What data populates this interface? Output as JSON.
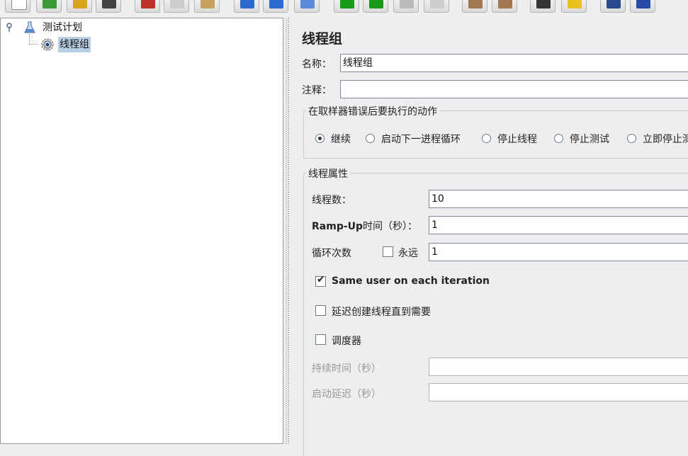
{
  "toolbar": {
    "buttons": [
      {
        "icon": "new-icon",
        "color": "#ffffff"
      },
      {
        "icon": "templates-icon",
        "color": "#3a9a3a"
      },
      {
        "icon": "open-icon",
        "color": "#d8a520"
      },
      {
        "icon": "save-icon",
        "color": "#444444"
      },
      {
        "icon": "cut-icon",
        "color": "#c0302a"
      },
      {
        "icon": "copy-icon",
        "color": "#cccccc"
      },
      {
        "icon": "paste-icon",
        "color": "#c8a060"
      },
      {
        "icon": "expand-icon",
        "color": "#2a6ad0"
      },
      {
        "icon": "collapse-icon",
        "color": "#2a6ad0"
      },
      {
        "icon": "toggle-icon",
        "color": "#5a8ad8"
      },
      {
        "icon": "start-icon",
        "color": "#1a9a1a"
      },
      {
        "icon": "start-no-pause-icon",
        "color": "#1a9a1a"
      },
      {
        "icon": "stop-icon",
        "color": "#bbbbbb"
      },
      {
        "icon": "shutdown-icon",
        "color": "#cccccc"
      },
      {
        "icon": "clear-icon",
        "color": "#a07850"
      },
      {
        "icon": "clear-all-icon",
        "color": "#a07850"
      },
      {
        "icon": "search-icon",
        "color": "#333333"
      },
      {
        "icon": "reset-search-icon",
        "color": "#e8c020"
      },
      {
        "icon": "function-helper-icon",
        "color": "#2a4a90"
      },
      {
        "icon": "help-icon",
        "color": "#2a4aa8"
      }
    ]
  },
  "tree": {
    "root": {
      "label": "测试计划",
      "icon": "test-plan-icon"
    },
    "child": {
      "label": "线程组",
      "icon": "gear-icon",
      "selected": true
    }
  },
  "editor": {
    "title": "线程组",
    "name_label": "名称：",
    "name_value": "线程组",
    "comment_label": "注释：",
    "comment_value": "",
    "error_action": {
      "legend": "在取样器错误后要执行的动作",
      "options": [
        {
          "label": "继续",
          "selected": true
        },
        {
          "label": "启动下一进程循环",
          "selected": false
        },
        {
          "label": "停止线程",
          "selected": false
        },
        {
          "label": "停止测试",
          "selected": false
        },
        {
          "label": "立即停止测试",
          "selected": false
        }
      ]
    },
    "thread_props": {
      "legend": "线程属性",
      "threads_label": "线程数：",
      "threads_value": "10",
      "rampup_label_bold": "Ramp-Up",
      "rampup_label_rest": "时间（秒）：",
      "rampup_value": "1",
      "loop_label": "循环次数",
      "forever_label": "永远",
      "forever_checked": false,
      "loop_value": "1",
      "same_user_label": "Same user on each iteration",
      "same_user_checked": true,
      "delay_create_label": "延迟创建线程直到需要",
      "delay_create_checked": false,
      "scheduler_label": "调度器",
      "scheduler_checked": false,
      "duration_label": "持续时间（秒）",
      "duration_value": "",
      "startup_delay_label": "启动延迟（秒）",
      "startup_delay_value": ""
    }
  }
}
